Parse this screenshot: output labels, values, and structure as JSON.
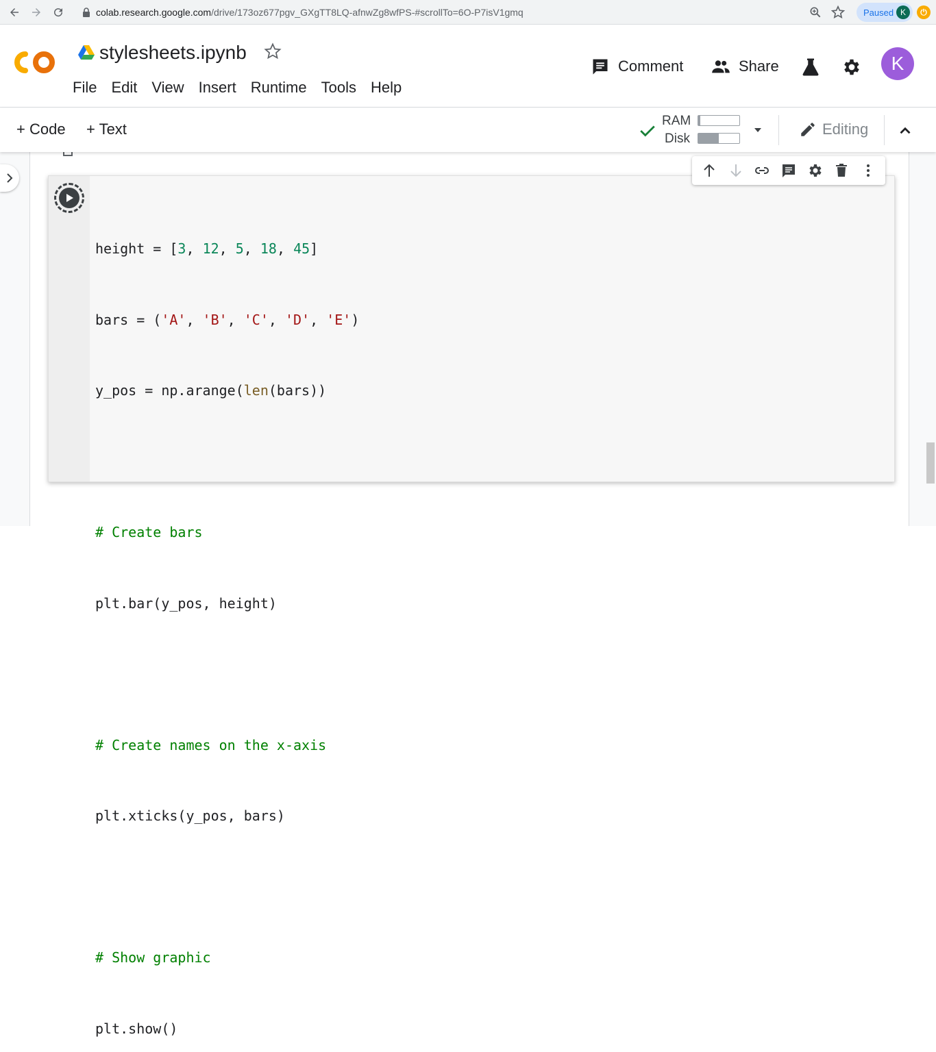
{
  "browser": {
    "url_host": "colab.research.google.com",
    "url_rest": "/drive/173oz677pgv_GXgTT8LQ-afnwZg8wfPS-#scrollTo=6O-P7isV1gmq",
    "paused_label": "Paused",
    "profile_initial": "K"
  },
  "header": {
    "logo": "CO",
    "title": "stylesheets.ipynb",
    "menu": [
      "File",
      "Edit",
      "View",
      "Insert",
      "Runtime",
      "Tools",
      "Help"
    ],
    "comment_label": "Comment",
    "share_label": "Share",
    "avatar_initial": "K"
  },
  "toolbar": {
    "add_code_label": "+ Code",
    "add_text_label": "+ Text",
    "ram_label": "RAM",
    "disk_label": "Disk",
    "ram_usage": 0.05,
    "disk_usage": 0.5,
    "editing_label": "Editing",
    "status": "connected"
  },
  "cell": {
    "code_lines": [
      "height = [3, 12, 5, 18, 45]",
      "bars = ('A', 'B', 'C', 'D', 'E')",
      "y_pos = np.arange(len(bars))",
      "",
      "# Create bars",
      "plt.bar(y_pos, height)",
      "",
      "# Create names on the x-axis",
      "plt.xticks(y_pos, bars)",
      "",
      "# Show graphic",
      "plt.show()"
    ]
  },
  "colors": {
    "accent_blue": "#1a73e8",
    "avatar_purple": "#9c5ddb",
    "check_green": "#188038",
    "logo_yellow": "#f9ab00",
    "logo_orange": "#e8710a"
  }
}
